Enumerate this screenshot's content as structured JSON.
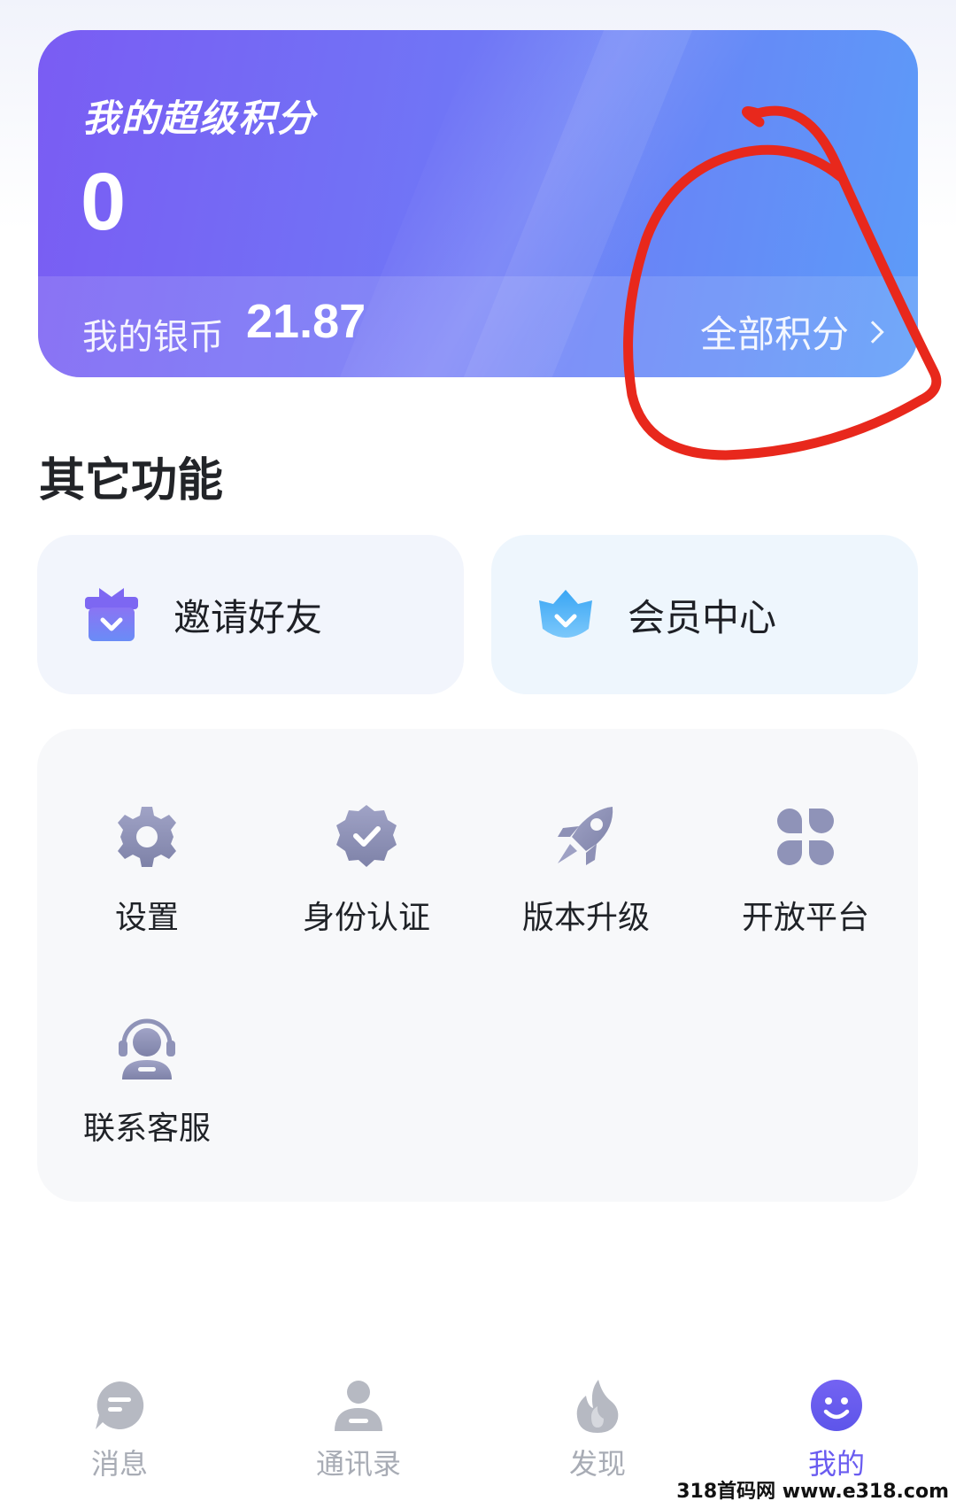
{
  "points_card": {
    "title": "我的超级积分",
    "points": "0",
    "silver_label": "我的银币",
    "silver_value": "21.87",
    "all_points_label": "全部积分"
  },
  "section": {
    "title": "其它功能"
  },
  "quick_actions": [
    {
      "label": "邀请好友",
      "icon": "gift-icon"
    },
    {
      "label": "会员中心",
      "icon": "crown-shield-icon"
    }
  ],
  "functions": [
    {
      "label": "设置",
      "icon": "gear-icon"
    },
    {
      "label": "身份认证",
      "icon": "verified-badge-icon"
    },
    {
      "label": "版本升级",
      "icon": "rocket-icon"
    },
    {
      "label": "开放平台",
      "icon": "grid-icon"
    },
    {
      "label": "联系客服",
      "icon": "headset-agent-icon"
    }
  ],
  "bottom_nav": [
    {
      "label": "消息",
      "icon": "message-icon",
      "active": false
    },
    {
      "label": "通讯录",
      "icon": "contacts-icon",
      "active": false
    },
    {
      "label": "发现",
      "icon": "flame-icon",
      "active": false
    },
    {
      "label": "我的",
      "icon": "smiley-icon",
      "active": true
    }
  ],
  "watermark": "318首码网 www.e318.com",
  "colors": {
    "card_gradient_start": "#7a5cf3",
    "card_gradient_end": "#5c9cf8",
    "nav_active": "#6a5cf0",
    "nav_inactive": "#a8acb5",
    "annotation": "#e8281c"
  }
}
